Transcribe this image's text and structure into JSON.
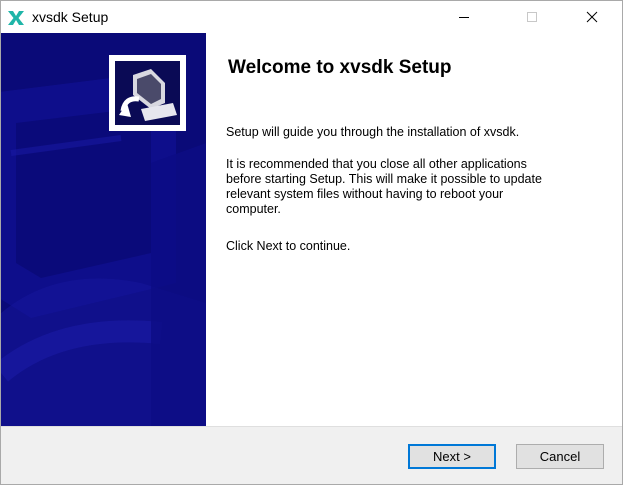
{
  "window": {
    "title": "xvsdk Setup",
    "accent_color": "#0078d7",
    "app_icon": "xvsdk-logo-icon"
  },
  "titlebar_controls": {
    "minimize_icon": "minimize-icon",
    "maximize_icon": "maximize-icon",
    "close_icon": "close-icon"
  },
  "banner": {
    "color": "#0a0a7a",
    "installer_icon": "installer-computer-icon"
  },
  "content": {
    "heading": "Welcome to xvsdk Setup",
    "paragraph1": "Setup will guide you through the installation of xvsdk.",
    "paragraph2": "It is recommended that you close all other applications\nbefore starting Setup. This will make it possible to update\nrelevant system files without having to reboot your\ncomputer.",
    "paragraph3": "Click Next to continue."
  },
  "footer": {
    "next_label": "Next >",
    "cancel_label": "Cancel"
  }
}
